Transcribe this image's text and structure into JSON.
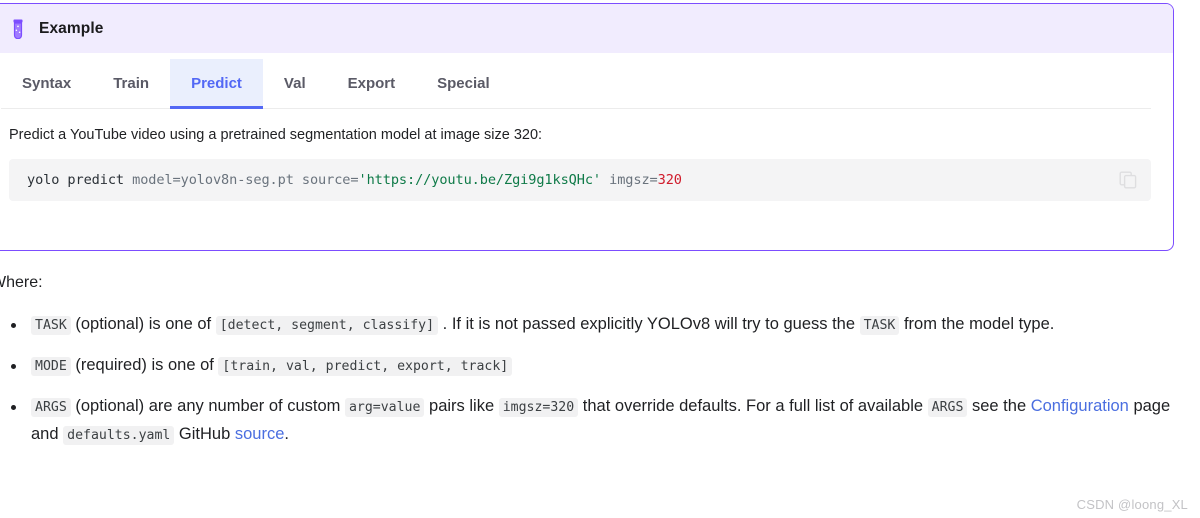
{
  "admonition": {
    "icon": "test-tube-icon",
    "title": "Example",
    "border_color": "#7c4dff",
    "header_bg": "#f1ecfe"
  },
  "tabs": {
    "active_index": 2,
    "active_color": "#5368f5",
    "active_bg": "#eaeffd",
    "items": [
      {
        "label": "Syntax"
      },
      {
        "label": "Train"
      },
      {
        "label": "Predict"
      },
      {
        "label": "Val"
      },
      {
        "label": "Export"
      },
      {
        "label": "Special"
      }
    ]
  },
  "panel": {
    "description": "Predict a YouTube video using a pretrained segmentation model at image size 320:",
    "code": {
      "command": "yolo predict ",
      "arg_model": "model=yolov8n-seg.pt ",
      "arg_source_key": "source=",
      "source_value": "'https://youtu.be/Zgi9g1ksQHc'",
      "space": " ",
      "arg_imgsz_key": "imgsz=",
      "imgsz_value": "320",
      "full_text": "yolo predict model=yolov8n-seg.pt source='https://youtu.be/Zgi9g1ksQHc' imgsz=320"
    },
    "copy_button_label": "copy-icon"
  },
  "where": {
    "heading": "Where:",
    "bullets": {
      "task": {
        "code": "TASK",
        "part1": " (optional) is one of ",
        "code2": "[detect, segment, classify]",
        "part2": " . If it is not passed explicitly YOLOv8 will try to guess the ",
        "code3": "TASK",
        "part3": " from the model type."
      },
      "mode": {
        "code": "MODE",
        "part1": " (required) is one of ",
        "code2": "[train, val, predict, export, track]"
      },
      "args": {
        "code": "ARGS",
        "part1": " (optional) are any number of custom ",
        "code2": "arg=value",
        "part2": " pairs like ",
        "code3": "imgsz=320",
        "part3": " that override defaults. For a full list of available ",
        "code4": "ARGS",
        "part4": " see the ",
        "link1": "Configuration",
        "part5": " page and ",
        "code5": "defaults.yaml",
        "part6": " GitHub ",
        "link2": "source",
        "part7": "."
      }
    }
  },
  "watermark": {
    "text": "CSDN @loong_XL"
  }
}
